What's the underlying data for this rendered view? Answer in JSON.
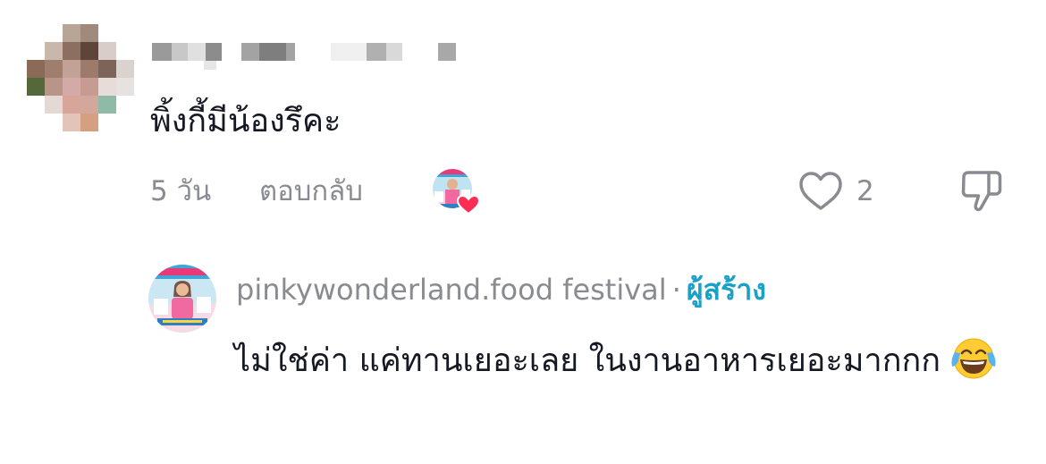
{
  "comment": {
    "text": "พิ้งกี้มีน้องรึคะ",
    "time": "5 วัน",
    "reply_label": "ตอบกลับ",
    "like_count": "2",
    "liked_by_creator": true
  },
  "reply": {
    "username": "pinkywonderland.food festival",
    "separator": "·",
    "creator_badge": "ผู้สร้าง",
    "text": "ไม่ใช่ค่า แค่ทานเยอะเลย ในงานอาหารเยอะมากกก",
    "emoji": "face-with-tears-of-joy"
  },
  "colors": {
    "text_primary": "#161823",
    "text_secondary": "#8a8b91",
    "creator_badge": "#1ba0c8",
    "heart_red": "#fe2c55"
  },
  "icons": {
    "like": "heart-outline-icon",
    "dislike": "thumbs-down-outline-icon",
    "creator_like": "heart-filled-icon"
  }
}
